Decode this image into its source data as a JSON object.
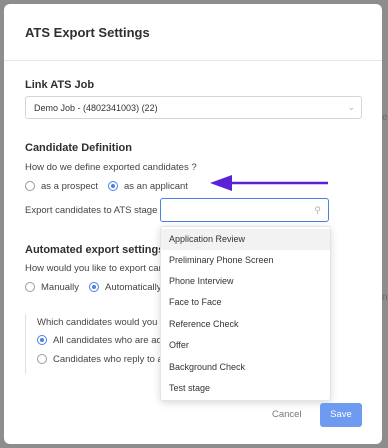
{
  "background": {
    "edge_labels": [
      "e",
      "n"
    ]
  },
  "modal": {
    "title": "ATS Export Settings",
    "link_section": {
      "title": "Link ATS Job",
      "selected_job": "Demo Job - (4802341003) (22)"
    },
    "candidate_definition": {
      "title": "Candidate Definition",
      "question": "How do we define exported candidates ?",
      "options": [
        "as a prospect",
        "as an applicant"
      ],
      "selected_index": 1,
      "stage_label": "Export candidates to ATS stage",
      "stage_value": "",
      "stage_options": [
        "Application Review",
        "Preliminary Phone Screen",
        "Phone Interview",
        "Face to Face",
        "Reference Check",
        "Offer",
        "Background Check",
        "Test stage"
      ],
      "highlighted_option_index": 0
    },
    "automated_export": {
      "title": "Automated export settings",
      "question": "How would you like to export can",
      "options": [
        "Manually",
        "Automatically"
      ],
      "selected_index": 1,
      "which_label": "Which candidates would you l",
      "which_options": [
        "All candidates who are ad",
        "Candidates who reply to a"
      ],
      "which_selected_index": 0
    },
    "footer": {
      "cancel_label": "Cancel",
      "save_label": "Save"
    }
  },
  "colors": {
    "accent": "#4a80e0",
    "arrow": "#5b21d6",
    "save_bg": "#6e9af0"
  }
}
